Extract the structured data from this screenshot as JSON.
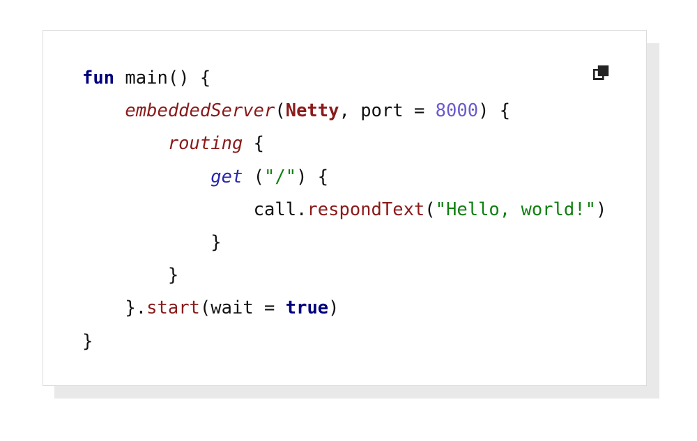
{
  "card": {
    "background_color": "#ffffff",
    "border_color": "#dcdcdc",
    "shadow_color": "#e9e9e9"
  },
  "toolbar": {
    "copy_icon": "copy-icon",
    "copy_label": ""
  },
  "palette": {
    "keyword": "#00007f",
    "function": "#8b1a1a",
    "type": "#8b1a1a",
    "dsl": "#2626b0",
    "string": "#108010",
    "number": "#6a5acd",
    "boolean": "#00007f",
    "plain": "#111111"
  },
  "code": {
    "language": "kotlin",
    "plain_text": "fun main() {\n    embeddedServer(Netty, port = 8000) {\n        routing {\n            get (\"/\") {\n                call.respondText(\"Hello, world!\")\n            }\n        }\n    }.start(wait = true)\n}",
    "lines": [
      {
        "indent": "",
        "tokens": [
          {
            "t": "fun",
            "c": "keyword"
          },
          {
            "t": " ",
            "c": "plain"
          },
          {
            "t": "main",
            "c": "plain"
          },
          {
            "t": "() {",
            "c": "plain"
          }
        ]
      },
      {
        "indent": "    ",
        "tokens": [
          {
            "t": "embeddedServer",
            "c": "fn-i"
          },
          {
            "t": "(",
            "c": "plain"
          },
          {
            "t": "Netty",
            "c": "type"
          },
          {
            "t": ", port = ",
            "c": "plain"
          },
          {
            "t": "8000",
            "c": "number"
          },
          {
            "t": ") {",
            "c": "plain"
          }
        ]
      },
      {
        "indent": "        ",
        "tokens": [
          {
            "t": "routing",
            "c": "fn-i"
          },
          {
            "t": " {",
            "c": "plain"
          }
        ]
      },
      {
        "indent": "            ",
        "tokens": [
          {
            "t": "get",
            "c": "dsl"
          },
          {
            "t": " (",
            "c": "plain"
          },
          {
            "t": "\"/\"",
            "c": "string"
          },
          {
            "t": ") {",
            "c": "plain"
          }
        ]
      },
      {
        "indent": "                ",
        "tokens": [
          {
            "t": "call.",
            "c": "plain"
          },
          {
            "t": "respondText",
            "c": "fn"
          },
          {
            "t": "(",
            "c": "plain"
          },
          {
            "t": "\"Hello, world!\"",
            "c": "string"
          },
          {
            "t": ")",
            "c": "plain"
          }
        ]
      },
      {
        "indent": "            ",
        "tokens": [
          {
            "t": "}",
            "c": "plain"
          }
        ]
      },
      {
        "indent": "        ",
        "tokens": [
          {
            "t": "}",
            "c": "plain"
          }
        ]
      },
      {
        "indent": "    ",
        "tokens": [
          {
            "t": "}.",
            "c": "plain"
          },
          {
            "t": "start",
            "c": "fn"
          },
          {
            "t": "(wait = ",
            "c": "plain"
          },
          {
            "t": "true",
            "c": "bool"
          },
          {
            "t": ")",
            "c": "plain"
          }
        ]
      },
      {
        "indent": "",
        "tokens": [
          {
            "t": "}",
            "c": "plain"
          }
        ]
      }
    ]
  }
}
